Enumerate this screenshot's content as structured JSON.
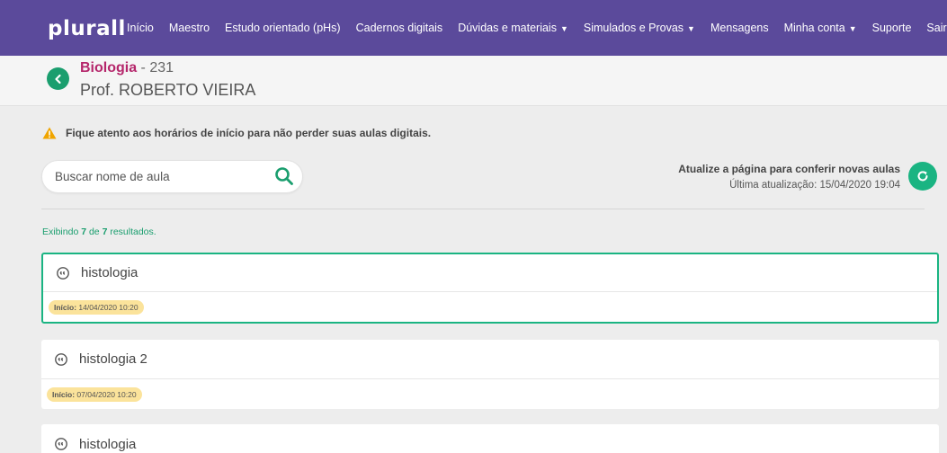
{
  "nav": {
    "logo": "plurall",
    "links": [
      {
        "label": "Início",
        "caret": false
      },
      {
        "label": "Maestro",
        "caret": false
      },
      {
        "label": "Estudo orientado (pHs)",
        "caret": false
      },
      {
        "label": "Cadernos digitais",
        "caret": false
      },
      {
        "label": "Dúvidas e materiais",
        "caret": true
      },
      {
        "label": "Simulados e Provas",
        "caret": true
      },
      {
        "label": "Mensagens",
        "caret": false
      },
      {
        "label": "Minha conta",
        "caret": true
      },
      {
        "label": "Suporte",
        "caret": false
      },
      {
        "label": "Sair",
        "caret": false
      }
    ]
  },
  "course": {
    "subject": "Biologia",
    "class_number": " - 231",
    "teacher": "Prof. ROBERTO VIEIRA"
  },
  "notice": "Fique atento aos horários de início para não perder suas aulas digitais.",
  "search": {
    "placeholder": "Buscar nome de aula",
    "value": ""
  },
  "refresh": {
    "title": "Atualize a página para conferir novas aulas",
    "updated": "Última atualização: 15/04/2020 19:04"
  },
  "results": {
    "prefix": "Exibindo ",
    "shown": "7",
    "middle": " de ",
    "total": "7",
    "suffix": " resultados."
  },
  "lessons": [
    {
      "name": "histologia",
      "start_label": "Início:",
      "start": " 14/04/2020 10:20",
      "active": true
    },
    {
      "name": "histologia 2",
      "start_label": "Início:",
      "start": " 07/04/2020 10:20",
      "active": false
    },
    {
      "name": "histologia",
      "start_label": "",
      "start": "",
      "active": false
    }
  ],
  "colors": {
    "nav_bg": "#5b4a9b",
    "accent_green": "#1ab482",
    "subject_magenta": "#b5266b",
    "badge_yellow": "#fbe39b"
  }
}
